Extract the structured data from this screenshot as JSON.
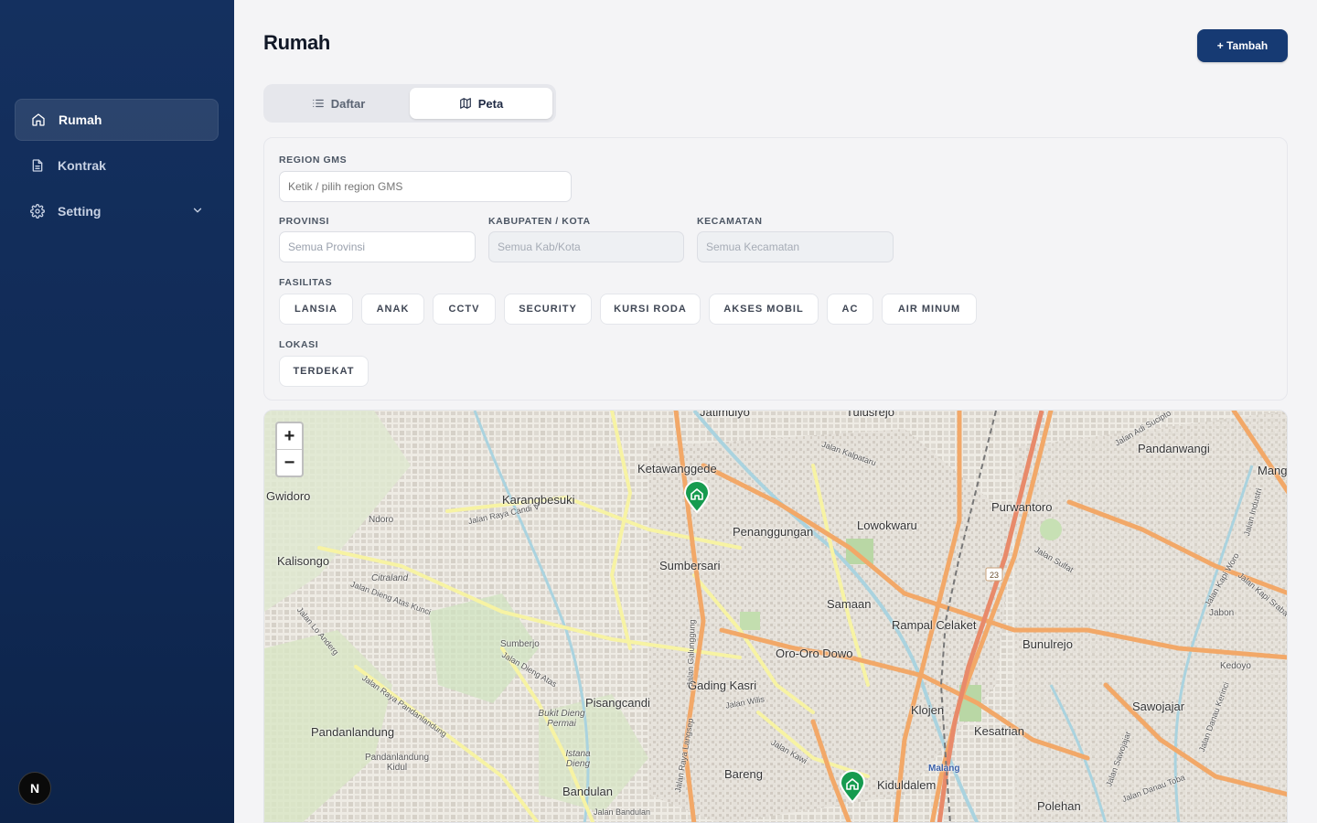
{
  "sidebar": {
    "items": [
      {
        "label": "Rumah",
        "icon": "home-icon",
        "active": true
      },
      {
        "label": "Kontrak",
        "icon": "document-icon",
        "active": false
      },
      {
        "label": "Setting",
        "icon": "gear-icon",
        "active": false
      }
    ],
    "badge": "N"
  },
  "header": {
    "title": "Rumah",
    "add_button": "+ Tambah"
  },
  "tabs": [
    {
      "label": "Daftar",
      "icon": "list-icon",
      "active": false
    },
    {
      "label": "Peta",
      "icon": "map-icon",
      "active": true
    }
  ],
  "filters": {
    "region_label": "REGION GMS",
    "region_placeholder": "Ketik / pilih region GMS",
    "provinsi_label": "PROVINSI",
    "provinsi_placeholder": "Semua Provinsi",
    "kabupaten_label": "KABUPATEN / KOTA",
    "kabupaten_placeholder": "Semua Kab/Kota",
    "kecamatan_label": "KECAMATAN",
    "kecamatan_placeholder": "Semua Kecamatan",
    "fasilitas_label": "FASILITAS",
    "fasilitas": [
      "LANSIA",
      "ANAK",
      "CCTV",
      "SECURITY",
      "KURSI RODA",
      "AKSES MOBIL",
      "AC",
      "AIR MINUM"
    ],
    "lokasi_label": "LOKASI",
    "lokasi_button": "TERDEKAT"
  },
  "map": {
    "zoom_in": "+",
    "zoom_out": "−",
    "places": [
      "Jatimulyo",
      "Tulusrejo",
      "Pandanwangi",
      "Ketawanggede",
      "Karangbesuki",
      "Gwidoro",
      "Ndoro",
      "Penanggungan",
      "Lowokwaru",
      "Purwantoro",
      "Kalisongo",
      "Sumbersari",
      "Samaan",
      "Rampal Celaket",
      "Bunulrejo",
      "Oro-Oro Dowo",
      "Sumberjo",
      "Gading Kasri",
      "Klojen",
      "Pisangcandi",
      "Kesatrian",
      "Sawojajar",
      "Pandanlandung",
      "Pandanlandung Kidul",
      "Bareng",
      "Bandulan",
      "Kiduldalem",
      "Polehan",
      "Malang",
      "Jabon",
      "Kedoyo",
      "Citraland",
      "Bukit Dieng Permai",
      "Istana Dieng",
      "Mang"
    ],
    "roads": [
      "Jalan Raya Candi V",
      "Jalan Kalpataru",
      "Jalan Sulfat",
      "Jalan Dieng Atas Kunci",
      "Jalan Lo Anderg",
      "Jalan Raya Pandanlandung",
      "Jalan Dieng Atas",
      "Jalan Galunggung",
      "Jalan Raya Langsep",
      "Jalan Kawi",
      "Jalan Wilis",
      "Jalan Bandulan",
      "Jalan Danau Toba",
      "Jalan Sawojajar",
      "Jalan Kapi Sraba",
      "Jalan Kapi Woro",
      "Jalan Adi Sucipto",
      "Jalan Danau Kerinci",
      "Jalan Industri"
    ],
    "markers": 2,
    "colors": {
      "marker": "#169b4f",
      "major_road": "#f3a56b",
      "secondary_road": "#f6f3a6"
    }
  },
  "colors": {
    "sidebar": "#14305f",
    "primary": "#163a73"
  }
}
